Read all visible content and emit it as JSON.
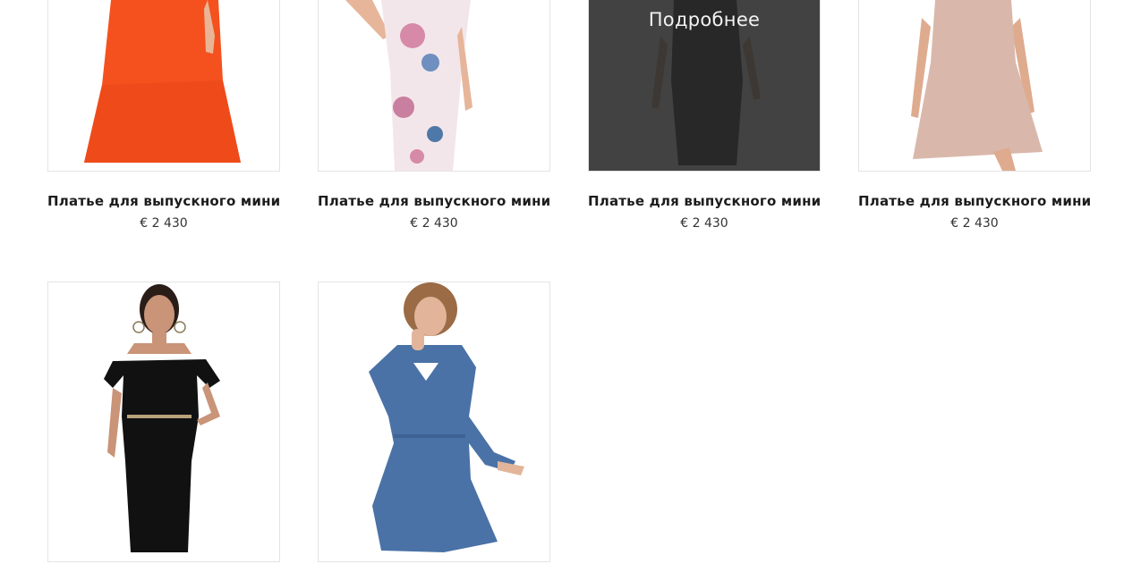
{
  "products": [
    {
      "title": "Платье для выпускного мини...",
      "price": "€ 2 430",
      "dress_color": "#f4511e",
      "hovered": false
    },
    {
      "title": "Платье для выпускного мини...",
      "price": "€ 2 430",
      "dress_color": "#f3e6ea",
      "hovered": false
    },
    {
      "title": "Платье для выпускного мини...",
      "price": "€ 2 430",
      "dress_color": "#2b2b2b",
      "hovered": true,
      "overlay_label": "Подробнее"
    },
    {
      "title": "Платье для выпускного мини...",
      "price": "€ 2 430",
      "dress_color": "#d9b8ab",
      "hovered": false
    },
    {
      "dress_color": "#111111",
      "hovered": false
    },
    {
      "dress_color": "#4a72a6",
      "hovered": false
    }
  ]
}
